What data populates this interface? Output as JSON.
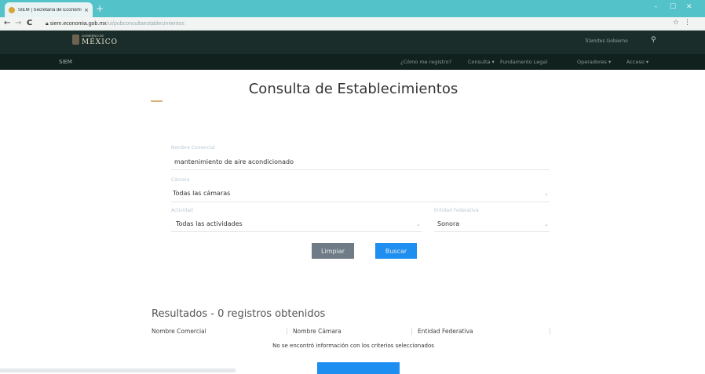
{
  "browser": {
    "tab_title": "SIEM | Secretaría de Economía",
    "tab_close": "×",
    "new_tab": "+",
    "window_controls": [
      "–",
      "☐",
      "✕"
    ],
    "nav": {
      "back": "←",
      "forward": "→",
      "reload": "C"
    },
    "url_host": "siem.economia.gob.mx",
    "url_path": "/ui/pubconsultaestablecimientos"
  },
  "gob_header": {
    "logo_small": "GOBIERNO DE",
    "logo_main": "MÉXICO",
    "links": "Trámites   Gobierno",
    "search_icon": "⚲"
  },
  "site_nav": {
    "brand": "SIEM",
    "items": [
      "¿Cómo me registro?",
      "Consulta ▾",
      "Fundamento Legal",
      "Operadores ▾",
      "Acceso ▾"
    ]
  },
  "page": {
    "title": "Consulta de Establecimientos"
  },
  "form": {
    "nombre_comercial": {
      "label": "Nombre Comercial",
      "value": "mantenimiento de aire acondicionado"
    },
    "camara": {
      "label": "Cámara",
      "value": "Todas las cámaras"
    },
    "actividad": {
      "label": "Actividad",
      "value": "Todas las actividades"
    },
    "entidad": {
      "label": "Entidad Federativa",
      "value": "Sonora"
    },
    "btn_limpiar": "Limpiar",
    "btn_buscar": "Buscar"
  },
  "results": {
    "title": "Resultados - 0 registros obtenidos",
    "columns": [
      "Nombre Comercial",
      "Nombre Cámara",
      "Entidad Federativa"
    ],
    "empty_message": "No se encontró información con los criterios seleccionados"
  }
}
